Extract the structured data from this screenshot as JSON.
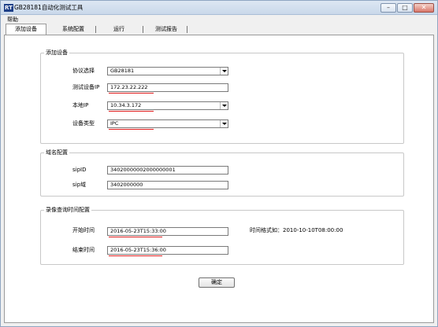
{
  "window": {
    "icon_text": "RT",
    "title": "GB28181自动化测试工具",
    "controls": [
      "–",
      "□",
      "✕"
    ]
  },
  "menu": {
    "help": "帮助"
  },
  "tabs": [
    "添加设备",
    "系统配置",
    "运行",
    "测试报告"
  ],
  "add_device": {
    "group_title": "添加设备",
    "protocol_label": "协议选择",
    "protocol_value": "GB28181",
    "test_device_ip_label": "测试设备IP",
    "test_device_ip_value": "172.23.22.222",
    "local_ip_label": "本地IP",
    "local_ip_value": "10.34.3.172",
    "device_type_label": "设备类型",
    "device_type_value": "IPC"
  },
  "domain_config": {
    "group_title": "域名配置",
    "sip_id_label": "sipID",
    "sip_id_value": "34020000002000000001",
    "sip_domain_label": "sip域",
    "sip_domain_value": "3402000000"
  },
  "record_query": {
    "group_title": "录像查询时间配置",
    "start_time_label": "开始时间",
    "start_time_value": "2016-05-23T15:33:00",
    "end_time_label": "结束时间",
    "end_time_value": "2016-05-23T15:36:00",
    "format_hint": "时间格式如：2010-10-10T08:00:00"
  },
  "confirm_button": "确定",
  "colors": {
    "highlight_underline": "#e11d1d",
    "title_bar": "#c9d8ea"
  }
}
